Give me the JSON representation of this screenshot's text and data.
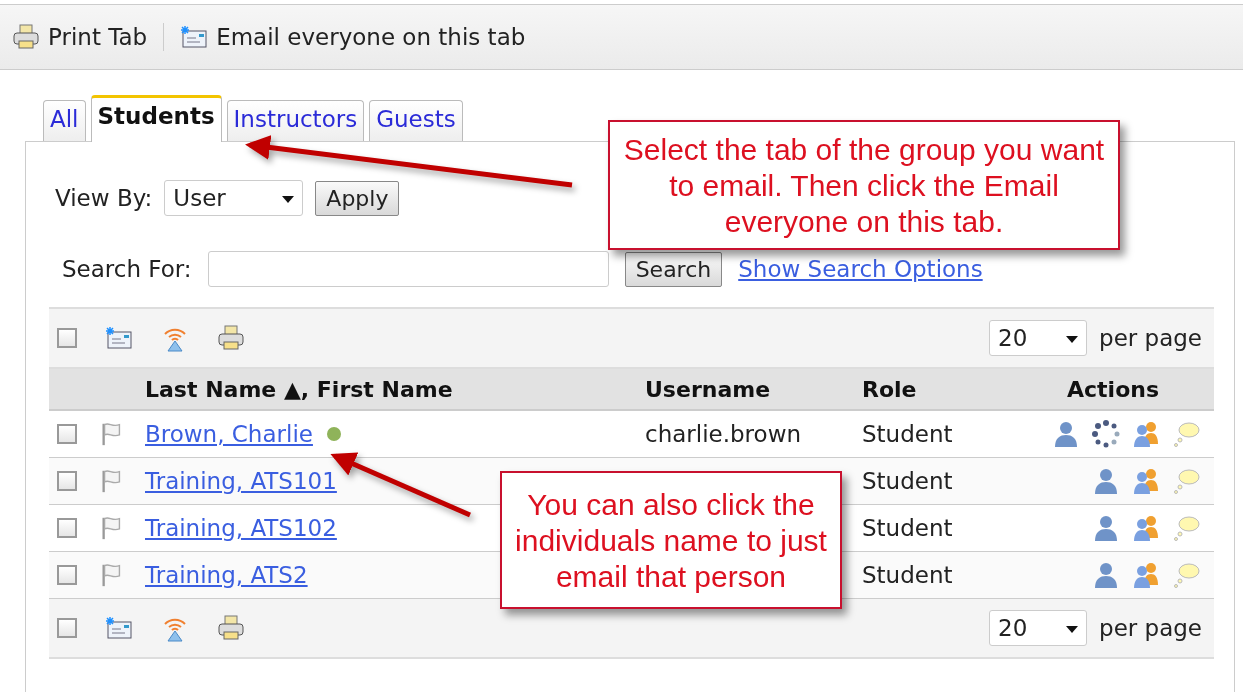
{
  "toolbar": [
    {
      "kind": "print",
      "label": "Print Tab"
    },
    {
      "kind": "email",
      "label": "Email everyone on this tab"
    }
  ],
  "tabs": [
    {
      "label": "All",
      "selected": false
    },
    {
      "label": "Students",
      "selected": true
    },
    {
      "label": "Instructors",
      "selected": false
    },
    {
      "label": "Guests",
      "selected": false
    }
  ],
  "view_by": {
    "label": "View By:",
    "value": "User",
    "button": "Apply"
  },
  "search": {
    "label": "Search For:",
    "button": "Search",
    "link": "Show Search Options"
  },
  "table": {
    "top_bar": {
      "checked": false,
      "tools": [
        {
          "kind": "email"
        },
        {
          "kind": "rss"
        },
        {
          "kind": "print"
        }
      ],
      "per_page": "20",
      "per_page_label": "per page"
    },
    "columns": [
      "Last Name ▲, First Name",
      "Username",
      "Role",
      "Actions"
    ],
    "rows": [
      {
        "checked": false,
        "name": "Brown, Charlie",
        "online": true,
        "username": "charlie.brown",
        "role": "Student",
        "actions": [
          {
            "kind": "profile"
          },
          {
            "kind": "progress"
          },
          {
            "kind": "groups"
          },
          {
            "kind": "chat"
          }
        ]
      },
      {
        "checked": false,
        "name": "Training, ATS101",
        "online": false,
        "role": "Student",
        "actions": [
          {
            "kind": "profile"
          },
          {
            "kind": "groups"
          },
          {
            "kind": "chat"
          }
        ]
      },
      {
        "checked": false,
        "name": "Training, ATS102",
        "online": false,
        "role": "Student",
        "actions": [
          {
            "kind": "profile"
          },
          {
            "kind": "groups"
          },
          {
            "kind": "chat"
          }
        ]
      },
      {
        "checked": false,
        "name": "Training, ATS2",
        "online": false,
        "role": "Student",
        "actions": [
          {
            "kind": "profile"
          },
          {
            "kind": "groups"
          },
          {
            "kind": "chat"
          }
        ]
      }
    ],
    "bottom_bar": {
      "checked": false,
      "tools": [
        {
          "kind": "email"
        },
        {
          "kind": "rss"
        },
        {
          "kind": "print"
        }
      ],
      "per_page": "20",
      "per_page_label": "per page"
    }
  },
  "callouts": [
    {
      "text": "Select the tab of the group you want to email.  Then click the Email everyone on this tab."
    },
    {
      "text": "You can also click the individuals name to just email that person"
    }
  ]
}
